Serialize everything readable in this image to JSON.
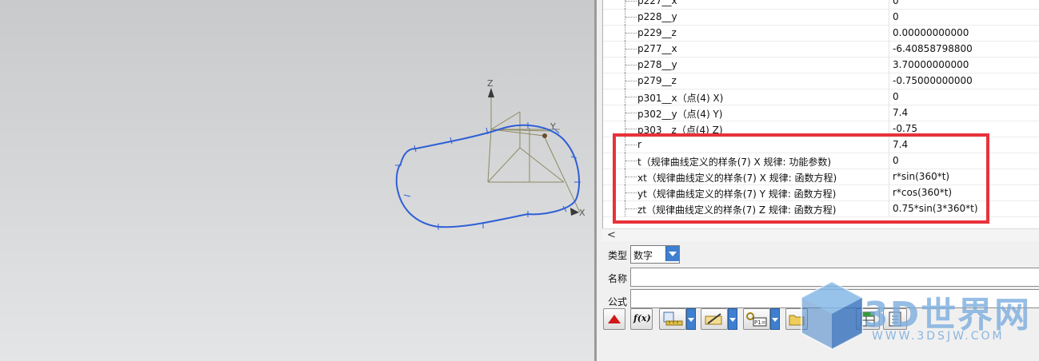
{
  "viewport": {
    "axis_labels": {
      "z": "Z",
      "y": "Y",
      "x": "X"
    }
  },
  "expressions": {
    "rows": [
      {
        "name": "p227__x",
        "value": "0"
      },
      {
        "name": "p228__y",
        "value": "0"
      },
      {
        "name": "p229__z",
        "value": "0.00000000000"
      },
      {
        "name": "p277__x",
        "value": "-6.40858798800"
      },
      {
        "name": "p278__y",
        "value": "3.70000000000"
      },
      {
        "name": "p279__z",
        "value": "-0.75000000000"
      },
      {
        "name": "p301__x（点(4) X)",
        "value": "0"
      },
      {
        "name": "p302__y（点(4) Y)",
        "value": "7.4"
      },
      {
        "name": "p303__z（点(4) Z)",
        "value": "-0.75"
      },
      {
        "name": "r",
        "value": "7.4"
      },
      {
        "name": "t（规律曲线定义的样条(7) X 规律: 功能参数)",
        "value": "0"
      },
      {
        "name": "xt（规律曲线定义的样条(7) X 规律: 函数方程)",
        "value": "r*sin(360*t)"
      },
      {
        "name": "yt（规律曲线定义的样条(7) Y 规律: 函数方程)",
        "value": "r*cos(360*t)"
      },
      {
        "name": "zt（规律曲线定义的样条(7) Z 规律: 函数方程)",
        "value": "0.75*sin(3*360*t)"
      }
    ],
    "scroll_left_glyph": "<"
  },
  "form": {
    "type_label": "类型",
    "type_value": "数字",
    "name_label": "名称",
    "name_value": "",
    "formula_label": "公式",
    "formula_value": ""
  },
  "toolbar": {
    "fx_label": "f(x)",
    "icons": [
      "red-triangle-up-icon",
      "function-icon",
      "measure-icon",
      "pencil-icon",
      "part-link-icon",
      "folder-open-icon",
      "spreadsheet-icon",
      "checklist-icon"
    ]
  },
  "watermark": {
    "brand": "3D世界网",
    "url": "WWW.3DSJW.COM"
  },
  "colors": {
    "curve": "#2f5fd6",
    "axis": "#8c8a63",
    "highlight": "#e8323a",
    "dropdown": "#3f7fd0"
  }
}
